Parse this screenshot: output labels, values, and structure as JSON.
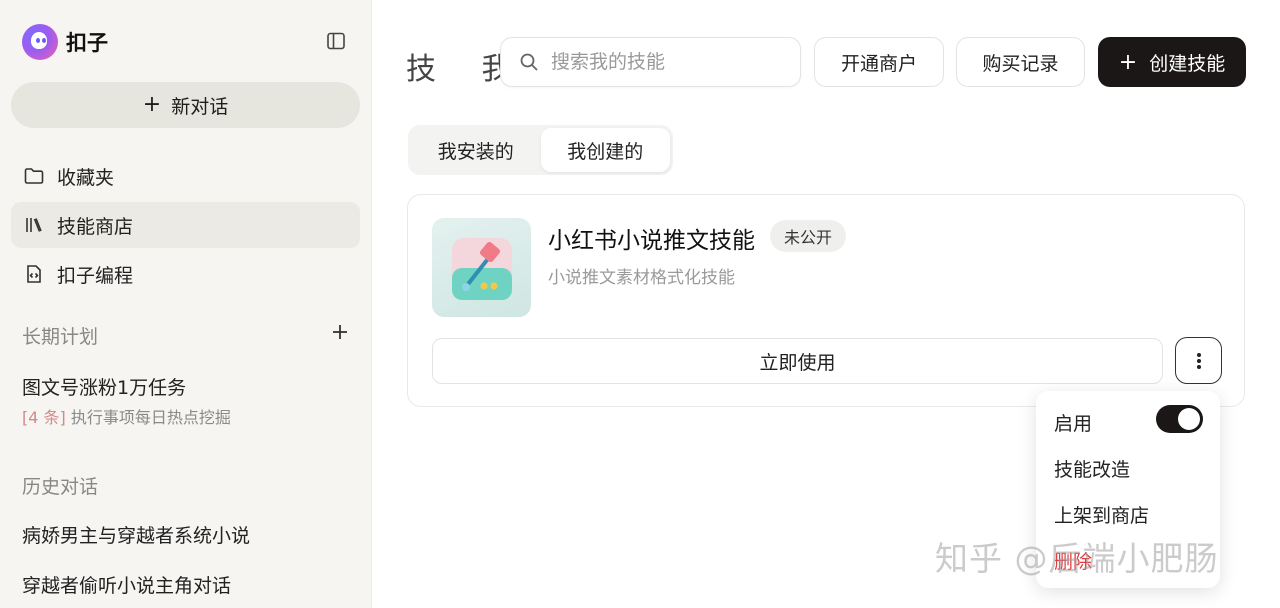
{
  "brand": {
    "name": "扣子"
  },
  "sidebar": {
    "new_chat": "新对话",
    "items": [
      {
        "label": "收藏夹",
        "icon": "folder-icon"
      },
      {
        "label": "技能商店",
        "icon": "library-icon"
      },
      {
        "label": "扣子编程",
        "icon": "code-file-icon"
      }
    ],
    "plans_title": "长期计划",
    "plan": {
      "title": "图文号涨粉1万任务",
      "count": "[4 条]",
      "desc": "执行事项每日热点挖掘"
    },
    "history_title": "历史对话",
    "history": [
      "病娇男主与穿越者系统小说",
      "穿越者偷听小说主角对话"
    ]
  },
  "header": {
    "title": "技 我",
    "search_placeholder": "搜索我的技能",
    "open_merchant": "开通商户",
    "purchase_records": "购买记录",
    "create_skill": "创建技能"
  },
  "tabs": [
    "我安装的",
    "我创建的"
  ],
  "skill": {
    "name": "小红书小说推文技能",
    "badge": "未公开",
    "desc": "小说推文素材格式化技能",
    "use": "立即使用"
  },
  "menu": {
    "enable": "启用",
    "enabled": true,
    "modify": "技能改造",
    "publish": "上架到商店",
    "delete": "删除"
  },
  "watermark": "知乎 @后端小肥肠",
  "colors": {
    "primary": "#1b1716",
    "danger": "#e0393e",
    "sidebar_bg": "#f6f5f2"
  }
}
